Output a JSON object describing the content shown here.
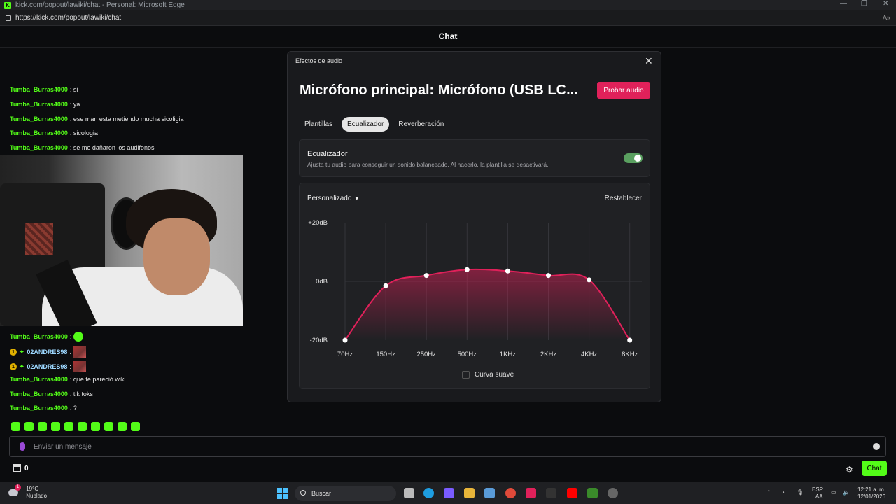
{
  "browser": {
    "title": "kick.com/popout/lawiki/chat - Personal: Microsoft Edge",
    "url": "https://kick.com/popout/lawiki/chat"
  },
  "chat": {
    "header": "Chat",
    "messages_top": [
      {
        "user": "Tumba_Burras4000",
        "text": ": si"
      },
      {
        "user": "Tumba_Burras4000",
        "text": ": ya"
      },
      {
        "user": "Tumba_Burras4000",
        "text": ": ese man esta metiendo mucha sicoligia"
      },
      {
        "user": "Tumba_Burras4000",
        "text": ": sicologia"
      },
      {
        "user": "Tumba_Burras4000",
        "text": ": se me dañaron los audifonos"
      }
    ],
    "messages_bottom": [
      {
        "user": "Tumba_Burras4000",
        "text": ":"
      },
      {
        "user": "02ANDRES98",
        "text": ":",
        "badge": "1"
      },
      {
        "user": "02ANDRES98",
        "text": ":",
        "badge": "1"
      },
      {
        "user": "Tumba_Burras4000",
        "text": ": que te pareció wiki"
      },
      {
        "user": "Tumba_Burras4000",
        "text": ": tik toks"
      },
      {
        "user": "Tumba_Burras4000",
        "text": ": ?"
      }
    ],
    "input_placeholder": "Enviar un mensaje",
    "store_count": "0",
    "send_label": "Chat"
  },
  "modal": {
    "title": "Efectos de audio",
    "heading": "Micrófono principal: Micrófono (USB LC...",
    "test_button": "Probar audio",
    "tabs": [
      "Plantillas",
      "Ecualizador",
      "Reverberación"
    ],
    "active_tab": "Ecualizador",
    "eq_card": {
      "title": "Ecualizador",
      "description": "Ajusta tu audio para conseguir un sonido balanceado. Al hacerlo, la plantilla se desactivará.",
      "enabled": true
    },
    "preset": "Personalizado",
    "reset": "Restablecer",
    "smooth_curve": "Curva suave"
  },
  "chart_data": {
    "type": "line",
    "categories": [
      "70Hz",
      "150Hz",
      "250Hz",
      "500Hz",
      "1KHz",
      "2KHz",
      "4KHz",
      "8KHz"
    ],
    "series": [
      {
        "values": [
          -20,
          -1.5,
          2,
          4,
          3.5,
          2,
          0.5,
          -20
        ]
      }
    ],
    "yticks": [
      "+20dB",
      "0dB",
      "-20dB"
    ],
    "ylim": [
      -20,
      20
    ],
    "color": "#e0215a"
  },
  "taskbar": {
    "temperature": "19°C",
    "condition": "Nublado",
    "search": "Buscar",
    "lang1": "ESP",
    "lang2": "LAA",
    "time": "12:21 a. m.",
    "date": "12/01/2026",
    "weather_badge": "1"
  }
}
